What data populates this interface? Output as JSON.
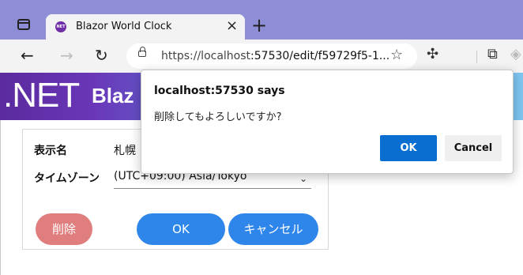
{
  "browser": {
    "tab_title": "Blazor World Clock",
    "favicon_text": "NET",
    "close_glyph": "×",
    "new_tab_glyph": "+",
    "url_host": "https://localhost",
    "url_rest": ":57530/edit/f59729f5-1..."
  },
  "banner": {
    "net_text": ".NET",
    "title": "Blaz"
  },
  "form": {
    "name_label": "表示名",
    "name_value": "札幌",
    "timezone_label": "タイムゾーン",
    "timezone_value": "(UTC+09:00) Asia/Tokyo",
    "delete_button": "削除",
    "ok_button": "OK",
    "cancel_button": "キャンセル"
  },
  "dialog": {
    "title": "localhost:57530 says",
    "message": "削除してもよろしいですか?",
    "ok_label": "OK",
    "cancel_label": "Cancel"
  },
  "colors": {
    "tabbar": "#8e8ed6",
    "primary_button": "#2f86ea",
    "danger_button": "#e07d7d",
    "dialog_ok": "#0a6ed1"
  }
}
